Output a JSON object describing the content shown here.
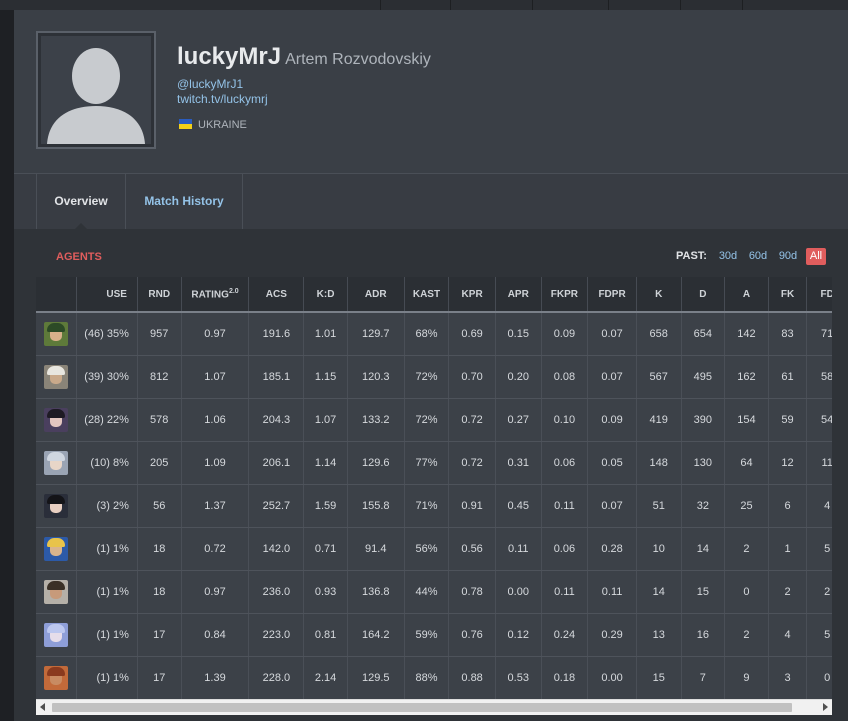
{
  "profile": {
    "alias": "luckyMrJ",
    "real_name": "Artem Rozvodovskiy",
    "twitter": "@luckyMrJ1",
    "twitch": "twitch.tv/luckymrj",
    "country": "UKRAINE",
    "flag_colors": [
      "#2a5cbf",
      "#f3d11a"
    ]
  },
  "tabs": [
    {
      "label": "Overview",
      "active": true
    },
    {
      "label": "Match History",
      "active": false
    }
  ],
  "agents_section": {
    "title": "AGENTS",
    "past_label": "PAST:",
    "periods": [
      {
        "label": "30d",
        "selected": false
      },
      {
        "label": "60d",
        "selected": false
      },
      {
        "label": "90d",
        "selected": false
      },
      {
        "label": "All",
        "selected": true
      }
    ],
    "columns": [
      "",
      "USE",
      "RND",
      "RATING",
      "ACS",
      "K:D",
      "ADR",
      "KAST",
      "KPR",
      "APR",
      "FKPR",
      "FDPR",
      "K",
      "D",
      "A",
      "FK",
      "FD"
    ],
    "rating_superscript": "2.0",
    "rows": [
      {
        "icon": "agent-icon-1",
        "use": "(46) 35%",
        "rnd": "957",
        "rating": "0.97",
        "acs": "191.6",
        "kd": "1.01",
        "adr": "129.7",
        "kast": "68%",
        "kpr": "0.69",
        "apr": "0.15",
        "fkpr": "0.09",
        "fdpr": "0.07",
        "k": "658",
        "d": "654",
        "a": "142",
        "fk": "83",
        "fd": "71"
      },
      {
        "icon": "agent-icon-2",
        "use": "(39) 30%",
        "rnd": "812",
        "rating": "1.07",
        "acs": "185.1",
        "kd": "1.15",
        "adr": "120.3",
        "kast": "72%",
        "kpr": "0.70",
        "apr": "0.20",
        "fkpr": "0.08",
        "fdpr": "0.07",
        "k": "567",
        "d": "495",
        "a": "162",
        "fk": "61",
        "fd": "58"
      },
      {
        "icon": "agent-icon-3",
        "use": "(28) 22%",
        "rnd": "578",
        "rating": "1.06",
        "acs": "204.3",
        "kd": "1.07",
        "adr": "133.2",
        "kast": "72%",
        "kpr": "0.72",
        "apr": "0.27",
        "fkpr": "0.10",
        "fdpr": "0.09",
        "k": "419",
        "d": "390",
        "a": "154",
        "fk": "59",
        "fd": "54"
      },
      {
        "icon": "agent-icon-4",
        "use": "(10) 8%",
        "rnd": "205",
        "rating": "1.09",
        "acs": "206.1",
        "kd": "1.14",
        "adr": "129.6",
        "kast": "77%",
        "kpr": "0.72",
        "apr": "0.31",
        "fkpr": "0.06",
        "fdpr": "0.05",
        "k": "148",
        "d": "130",
        "a": "64",
        "fk": "12",
        "fd": "11"
      },
      {
        "icon": "agent-icon-5",
        "use": "(3) 2%",
        "rnd": "56",
        "rating": "1.37",
        "acs": "252.7",
        "kd": "1.59",
        "adr": "155.8",
        "kast": "71%",
        "kpr": "0.91",
        "apr": "0.45",
        "fkpr": "0.11",
        "fdpr": "0.07",
        "k": "51",
        "d": "32",
        "a": "25",
        "fk": "6",
        "fd": "4"
      },
      {
        "icon": "agent-icon-6",
        "use": "(1) 1%",
        "rnd": "18",
        "rating": "0.72",
        "acs": "142.0",
        "kd": "0.71",
        "adr": "91.4",
        "kast": "56%",
        "kpr": "0.56",
        "apr": "0.11",
        "fkpr": "0.06",
        "fdpr": "0.28",
        "k": "10",
        "d": "14",
        "a": "2",
        "fk": "1",
        "fd": "5"
      },
      {
        "icon": "agent-icon-7",
        "use": "(1) 1%",
        "rnd": "18",
        "rating": "0.97",
        "acs": "236.0",
        "kd": "0.93",
        "adr": "136.8",
        "kast": "44%",
        "kpr": "0.78",
        "apr": "0.00",
        "fkpr": "0.11",
        "fdpr": "0.11",
        "k": "14",
        "d": "15",
        "a": "0",
        "fk": "2",
        "fd": "2"
      },
      {
        "icon": "agent-icon-8",
        "use": "(1) 1%",
        "rnd": "17",
        "rating": "0.84",
        "acs": "223.0",
        "kd": "0.81",
        "adr": "164.2",
        "kast": "59%",
        "kpr": "0.76",
        "apr": "0.12",
        "fkpr": "0.24",
        "fdpr": "0.29",
        "k": "13",
        "d": "16",
        "a": "2",
        "fk": "4",
        "fd": "5"
      },
      {
        "icon": "agent-icon-9",
        "use": "(1) 1%",
        "rnd": "17",
        "rating": "1.39",
        "acs": "228.0",
        "kd": "2.14",
        "adr": "129.5",
        "kast": "88%",
        "kpr": "0.88",
        "apr": "0.53",
        "fkpr": "0.18",
        "fdpr": "0.00",
        "k": "15",
        "d": "7",
        "a": "9",
        "fk": "3",
        "fd": "0"
      }
    ],
    "agent_icon_colors": [
      {
        "bg": "#5e7a3a",
        "face": "#d8b08a",
        "hair": "#2c4a26"
      },
      {
        "bg": "#8a8478",
        "face": "#c9a98a",
        "hair": "#e8e6df"
      },
      {
        "bg": "#4a3f5e",
        "face": "#e3c6c0",
        "hair": "#1e1a24"
      },
      {
        "bg": "#9aa4b4",
        "face": "#e8d6c8",
        "hair": "#cfd6e0"
      },
      {
        "bg": "#2a2e3a",
        "face": "#e8cfc2",
        "hair": "#141418"
      },
      {
        "bg": "#2c5aa8",
        "face": "#d9b48c",
        "hair": "#e8c34a"
      },
      {
        "bg": "#b5b0a8",
        "face": "#c79a7a",
        "hair": "#3a3026"
      },
      {
        "bg": "#8e9ed8",
        "face": "#e6ddea",
        "hair": "#bcc7ef"
      },
      {
        "bg": "#c26a3a",
        "face": "#c88b62",
        "hair": "#8a3a1e"
      }
    ]
  }
}
